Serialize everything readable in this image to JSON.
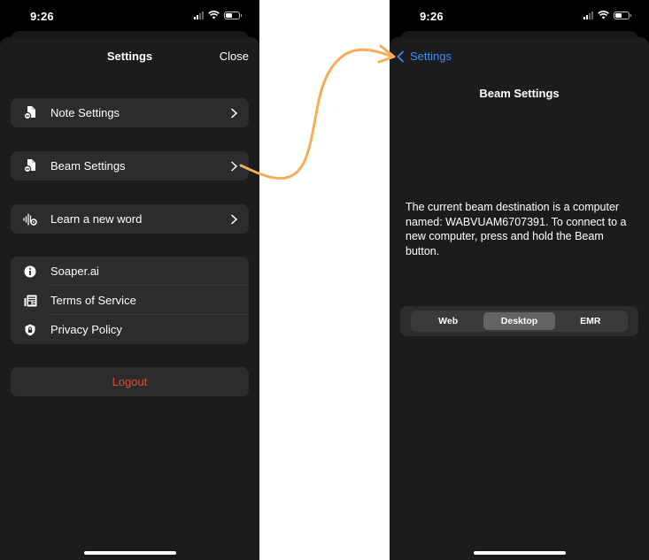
{
  "colors": {
    "arrow": "#f6ad55",
    "link_blue": "#3b8cf5",
    "logout_red": "#e0483c",
    "sheet_bg": "#1c1c1e",
    "card_bg": "#2c2c2e"
  },
  "left_screen": {
    "status_bar": {
      "time": "9:26",
      "battery_level": 0.5
    },
    "header": {
      "title": "Settings",
      "close_label": "Close"
    },
    "menu": [
      {
        "label": "Note Settings",
        "icon": "document-badge-icon"
      },
      {
        "label": "Beam Settings",
        "icon": "document-badge-icon"
      },
      {
        "label": "Learn a new word",
        "icon": "waveform-gear-icon"
      }
    ],
    "info_group": [
      {
        "label": "Soaper.ai",
        "icon": "info-circle-icon"
      },
      {
        "label": "Terms of Service",
        "icon": "newspaper-icon"
      },
      {
        "label": "Privacy Policy",
        "icon": "lock-shield-icon"
      }
    ],
    "logout_label": "Logout"
  },
  "right_screen": {
    "status_bar": {
      "time": "9:26",
      "battery_level": 0.5
    },
    "back_label": "Settings",
    "title": "Beam Settings",
    "description": "The current beam destination is a computer named: WABVUAM6707391. To connect to a new computer, press and hold the Beam button.",
    "segments": [
      "Web",
      "Desktop",
      "EMR"
    ],
    "selected_segment": "Desktop"
  },
  "annotation": {
    "type": "arrow",
    "from": "Beam Settings chevron",
    "to": "Settings back button"
  }
}
